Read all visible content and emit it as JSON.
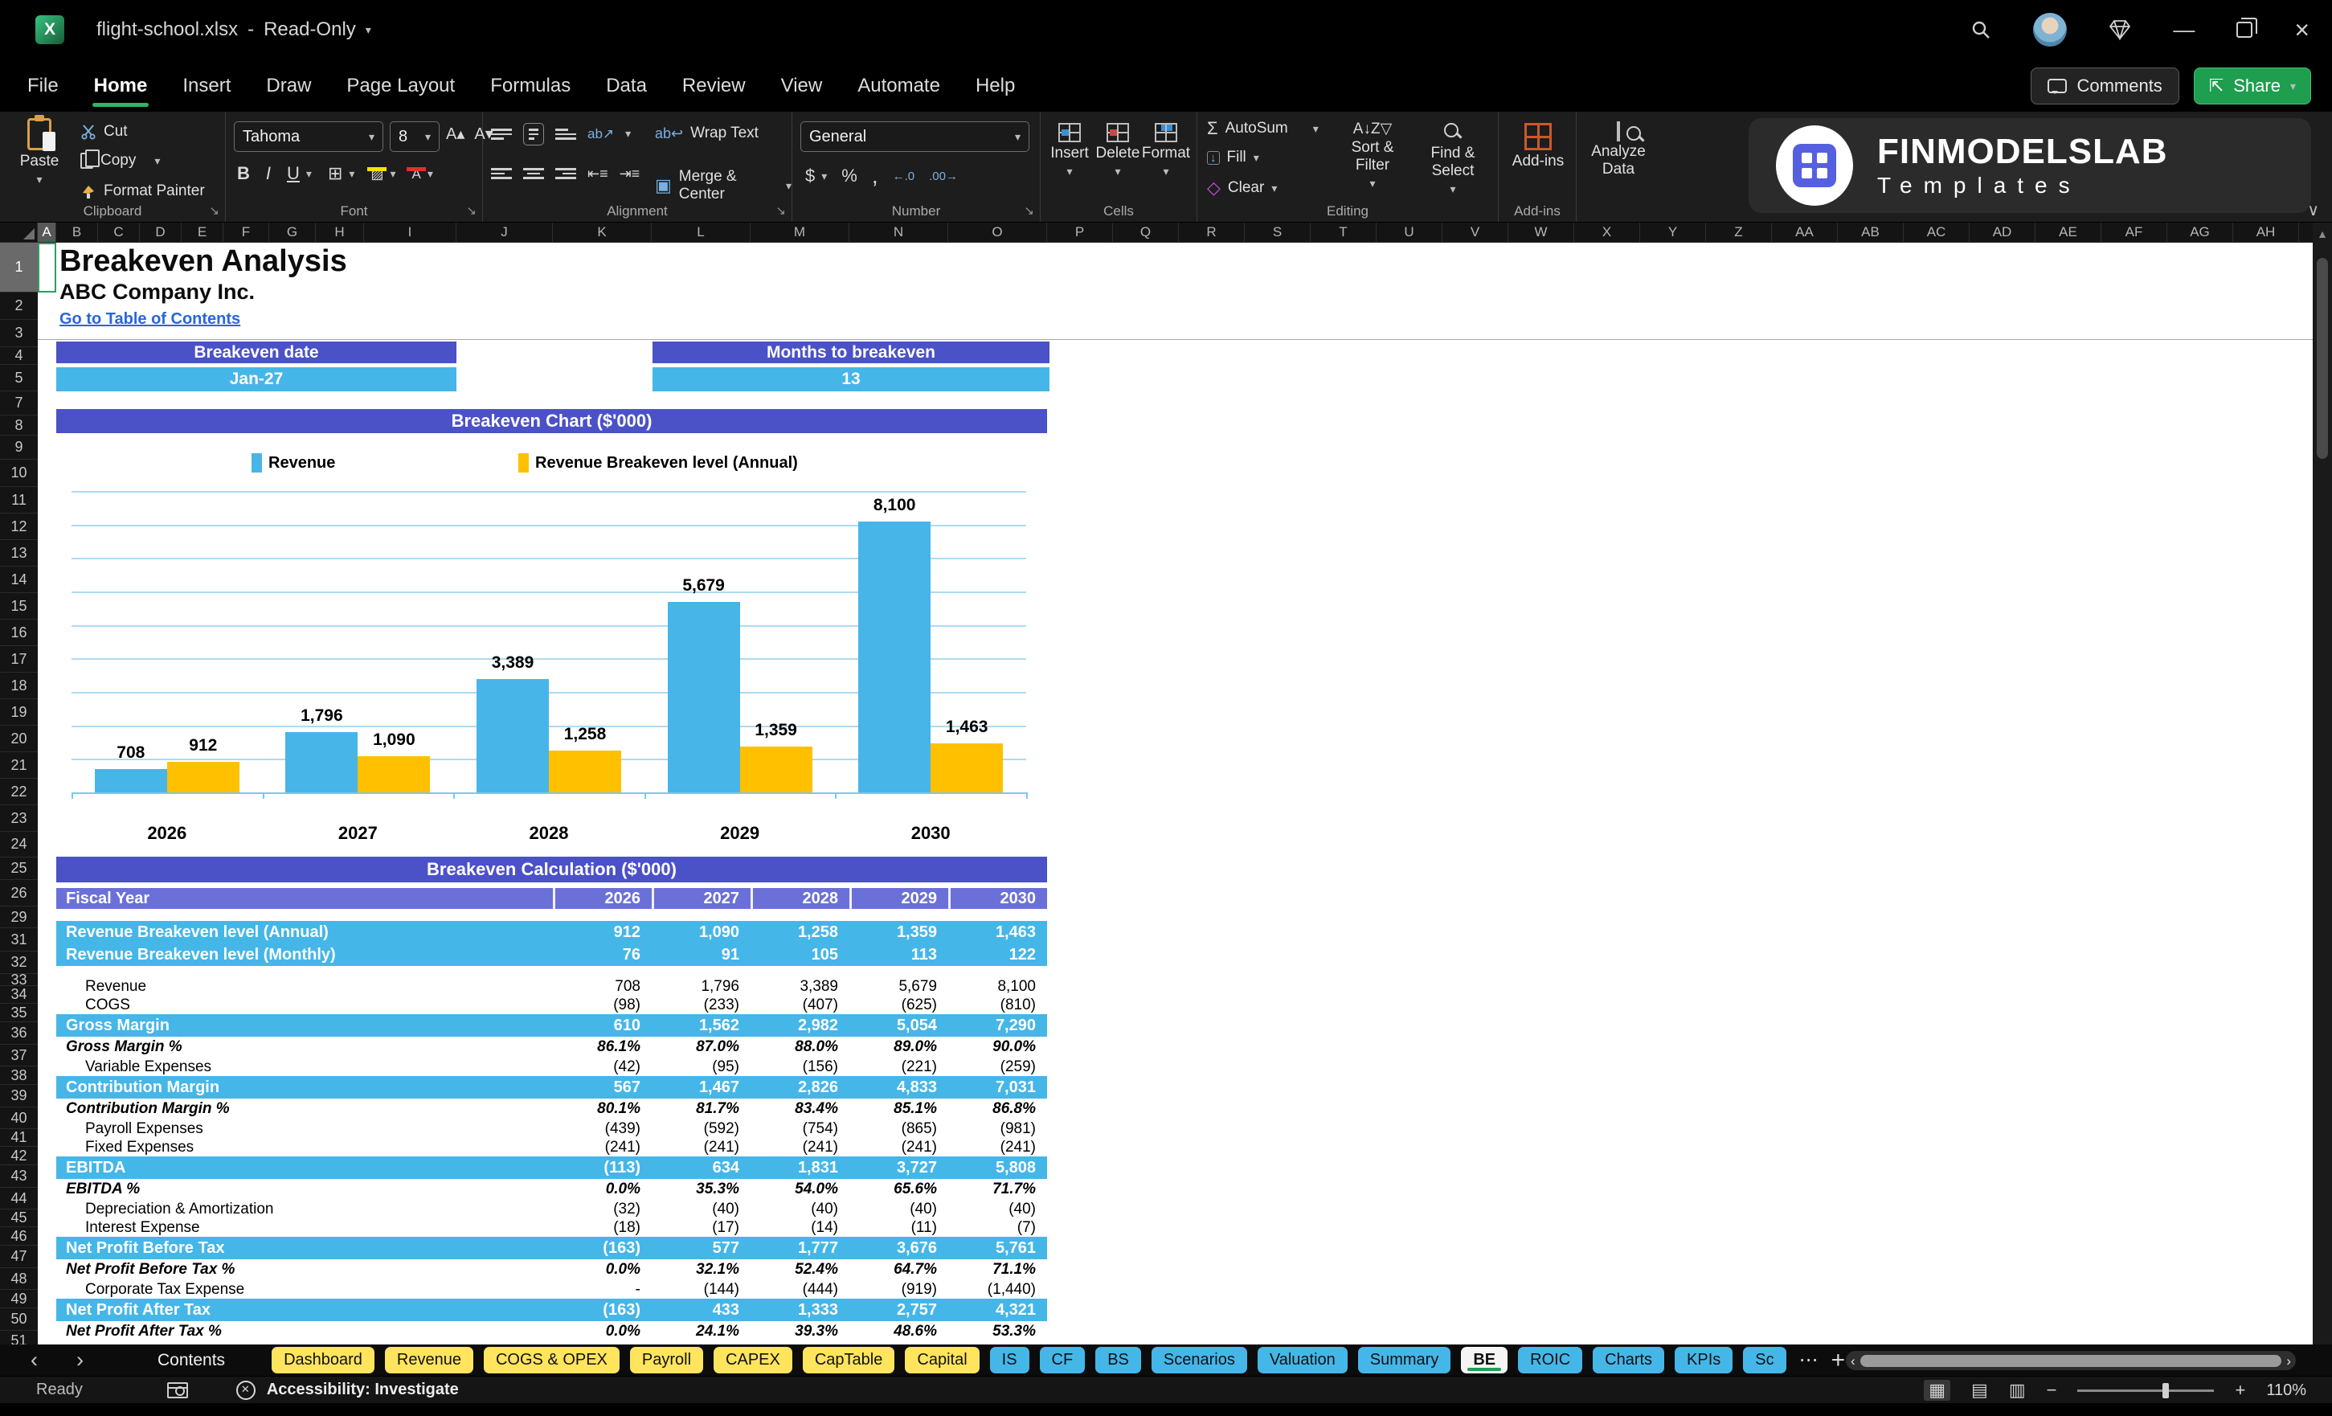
{
  "titlebar": {
    "filename": "flight-school.xlsx",
    "separator": "-",
    "mode": "Read-Only"
  },
  "menu": {
    "tabs": [
      "File",
      "Home",
      "Insert",
      "Draw",
      "Page Layout",
      "Formulas",
      "Data",
      "Review",
      "View",
      "Automate",
      "Help"
    ],
    "active": "Home",
    "comments_label": "Comments",
    "share_label": "Share"
  },
  "ribbon": {
    "clipboard": {
      "label": "Clipboard",
      "paste": "Paste",
      "cut": "Cut",
      "copy": "Copy",
      "format_painter": "Format Painter"
    },
    "font": {
      "label": "Font",
      "family": "Tahoma",
      "size": "8"
    },
    "alignment": {
      "label": "Alignment",
      "wrap": "Wrap Text",
      "merge": "Merge & Center"
    },
    "number": {
      "label": "Number",
      "format": "General"
    },
    "cells": {
      "label": "Cells",
      "insert": "Insert",
      "delete": "Delete",
      "format": "Format"
    },
    "editing": {
      "label": "Editing",
      "autosum": "AutoSum",
      "fill": "Fill",
      "clear": "Clear",
      "sort": "Sort & Filter",
      "find": "Find & Select"
    },
    "addins_label": "Add-ins",
    "analyze_label": "Analyze Data",
    "logo": {
      "brand": "FINMODELSLAB",
      "sub": "Templates"
    }
  },
  "icons": {
    "dropdown": "▾",
    "collapse": "∨",
    "nav_left": "‹",
    "nav_right": "›",
    "more": "⋯",
    "kebab": "⋮",
    "plus": "+",
    "minimize": "—",
    "close": "×",
    "diamond": "◇",
    "autosum": "Σ",
    "bold": "B",
    "italic": "I",
    "underline": "U",
    "borders": "⊞",
    "insert_cells": "⊞",
    "delete_cells": "⊠",
    "format_cells": "⊟",
    "currency": "$",
    "percent": "%",
    "comma": ",",
    "inc_decimal": "←.0",
    "dec_decimal": ".00→",
    "fill_down": "↓",
    "clear": "◇",
    "wrap": "↩",
    "merge": "▣",
    "orientation": "ab↗",
    "sortaz": "A↓Z",
    "fontgrow": "A▴",
    "fontshrink": "A▾",
    "uparrow": "▲"
  },
  "grid": {
    "columns_left": [
      "A",
      "B",
      "C",
      "D",
      "E",
      "F",
      "G",
      "H",
      "I",
      "J",
      "K",
      "L",
      "M",
      "N",
      "O"
    ],
    "columns_right": [
      "P",
      "Q",
      "R",
      "S",
      "T",
      "U",
      "V",
      "W",
      "X",
      "Y",
      "Z",
      "AA",
      "AB",
      "AC",
      "AD",
      "AE",
      "AF",
      "AG",
      "AH"
    ],
    "selected_column": "A",
    "selected_row": "1",
    "rows": [
      {
        "n": "1",
        "h": 62
      },
      {
        "n": "2",
        "h": 34
      },
      {
        "n": "3",
        "h": 34
      },
      {
        "n": "4",
        "h": 22
      },
      {
        "n": "5",
        "h": 33
      },
      {
        "n": "7",
        "h": 30
      },
      {
        "n": "8",
        "h": 25
      },
      {
        "n": "9",
        "h": 30
      },
      {
        "n": "10",
        "h": 34
      },
      {
        "n": "11",
        "h": 33
      },
      {
        "n": "12",
        "h": 33
      },
      {
        "n": "13",
        "h": 33
      },
      {
        "n": "14",
        "h": 33
      },
      {
        "n": "15",
        "h": 33
      },
      {
        "n": "16",
        "h": 33
      },
      {
        "n": "17",
        "h": 33
      },
      {
        "n": "18",
        "h": 33
      },
      {
        "n": "19",
        "h": 33
      },
      {
        "n": "20",
        "h": 33
      },
      {
        "n": "21",
        "h": 33
      },
      {
        "n": "22",
        "h": 33
      },
      {
        "n": "23",
        "h": 33
      },
      {
        "n": "24",
        "h": 32
      },
      {
        "n": "25",
        "h": 28
      },
      {
        "n": "26",
        "h": 33
      },
      {
        "n": "29",
        "h": 27
      },
      {
        "n": "31",
        "h": 29
      },
      {
        "n": "32",
        "h": 28
      },
      {
        "n": "33",
        "h": 15
      },
      {
        "n": "34",
        "h": 22
      },
      {
        "n": "35",
        "h": 23
      },
      {
        "n": "36",
        "h": 28
      },
      {
        "n": "37",
        "h": 27
      },
      {
        "n": "38",
        "h": 23
      },
      {
        "n": "39",
        "h": 28
      },
      {
        "n": "40",
        "h": 27
      },
      {
        "n": "41",
        "h": 22
      },
      {
        "n": "42",
        "h": 23
      },
      {
        "n": "43",
        "h": 28
      },
      {
        "n": "44",
        "h": 27
      },
      {
        "n": "45",
        "h": 22
      },
      {
        "n": "46",
        "h": 23
      },
      {
        "n": "47",
        "h": 28
      },
      {
        "n": "48",
        "h": 27
      },
      {
        "n": "49",
        "h": 23
      },
      {
        "n": "50",
        "h": 28
      },
      {
        "n": "51",
        "h": 25
      }
    ]
  },
  "sheet": {
    "title": "Breakeven Analysis",
    "company": "ABC Company Inc.",
    "link": "Go to Table of Contents",
    "kpis": [
      {
        "label": "Breakeven date",
        "value": "Jan-27"
      },
      {
        "label": "Months to breakeven",
        "value": "13"
      }
    ],
    "chart_title": "Breakeven Chart ($'000)",
    "table_title": "Breakeven Calculation ($'000)"
  },
  "chart_data": {
    "type": "bar",
    "title": "Breakeven Chart ($'000)",
    "categories": [
      "2026",
      "2027",
      "2028",
      "2029",
      "2030"
    ],
    "series": [
      {
        "name": "Revenue",
        "color": "#47b5e8",
        "values": [
          708,
          1796,
          3389,
          5679,
          8100
        ],
        "labels": [
          "708",
          "1,796",
          "3,389",
          "5,679",
          "8,100"
        ]
      },
      {
        "name": "Revenue Breakeven level (Annual)",
        "color": "#ffc000",
        "values": [
          912,
          1090,
          1258,
          1359,
          1463
        ],
        "labels": [
          "912",
          "1,090",
          "1,258",
          "1,359",
          "1,463"
        ]
      }
    ],
    "ylim": [
      0,
      9000
    ],
    "gridline_step": 1000,
    "grid": true,
    "legend_position": "top"
  },
  "table": {
    "header_row": {
      "label": "Fiscal Year",
      "years": [
        "2026",
        "2027",
        "2028",
        "2029",
        "2030"
      ]
    },
    "rows": [
      {
        "label": "Revenue Breakeven level (Annual)",
        "style": "highlight",
        "values": [
          "912",
          "1,090",
          "1,258",
          "1,359",
          "1,463"
        ]
      },
      {
        "label": "Revenue Breakeven level (Monthly)",
        "style": "highlight",
        "values": [
          "76",
          "91",
          "105",
          "113",
          "122"
        ]
      },
      {
        "label": "",
        "style": "spacer",
        "values": [
          "",
          "",
          "",
          "",
          ""
        ]
      },
      {
        "label": "Revenue",
        "style": "item",
        "values": [
          "708",
          "1,796",
          "3,389",
          "5,679",
          "8,100"
        ]
      },
      {
        "label": "COGS",
        "style": "item",
        "values": [
          "(98)",
          "(233)",
          "(407)",
          "(625)",
          "(810)"
        ]
      },
      {
        "label": "Gross Margin",
        "style": "highlight",
        "values": [
          "610",
          "1,562",
          "2,982",
          "5,054",
          "7,290"
        ]
      },
      {
        "label": "Gross Margin %",
        "style": "pct",
        "values": [
          "86.1%",
          "87.0%",
          "88.0%",
          "89.0%",
          "90.0%"
        ]
      },
      {
        "label": "Variable Expenses",
        "style": "item",
        "values": [
          "(42)",
          "(95)",
          "(156)",
          "(221)",
          "(259)"
        ]
      },
      {
        "label": "Contribution Margin",
        "style": "highlight",
        "values": [
          "567",
          "1,467",
          "2,826",
          "4,833",
          "7,031"
        ]
      },
      {
        "label": "Contribution Margin %",
        "style": "pct",
        "values": [
          "80.1%",
          "81.7%",
          "83.4%",
          "85.1%",
          "86.8%"
        ]
      },
      {
        "label": "Payroll Expenses",
        "style": "item",
        "values": [
          "(439)",
          "(592)",
          "(754)",
          "(865)",
          "(981)"
        ]
      },
      {
        "label": "Fixed Expenses",
        "style": "item",
        "values": [
          "(241)",
          "(241)",
          "(241)",
          "(241)",
          "(241)"
        ]
      },
      {
        "label": "EBITDA",
        "style": "highlight",
        "values": [
          "(113)",
          "634",
          "1,831",
          "3,727",
          "5,808"
        ]
      },
      {
        "label": "EBITDA %",
        "style": "pct",
        "values": [
          "0.0%",
          "35.3%",
          "54.0%",
          "65.6%",
          "71.7%"
        ]
      },
      {
        "label": "Depreciation & Amortization",
        "style": "item",
        "values": [
          "(32)",
          "(40)",
          "(40)",
          "(40)",
          "(40)"
        ]
      },
      {
        "label": "Interest Expense",
        "style": "item",
        "values": [
          "(18)",
          "(17)",
          "(14)",
          "(11)",
          "(7)"
        ]
      },
      {
        "label": "Net Profit Before Tax",
        "style": "highlight",
        "values": [
          "(163)",
          "577",
          "1,777",
          "3,676",
          "5,761"
        ]
      },
      {
        "label": "Net Profit Before Tax %",
        "style": "pct",
        "values": [
          "0.0%",
          "32.1%",
          "52.4%",
          "64.7%",
          "71.1%"
        ]
      },
      {
        "label": "Corporate Tax Expense",
        "style": "item",
        "values": [
          "-",
          "(144)",
          "(444)",
          "(919)",
          "(1,440)"
        ]
      },
      {
        "label": "Net Profit After Tax",
        "style": "highlight",
        "values": [
          "(163)",
          "433",
          "1,333",
          "2,757",
          "4,321"
        ]
      },
      {
        "label": "Net Profit After Tax %",
        "style": "pct",
        "values": [
          "0.0%",
          "24.1%",
          "39.3%",
          "48.6%",
          "53.3%"
        ]
      }
    ]
  },
  "tabs": {
    "contents_label": "Contents",
    "items": [
      {
        "label": "Dashboard",
        "color": "yellow"
      },
      {
        "label": "Revenue",
        "color": "yellow"
      },
      {
        "label": "COGS & OPEX",
        "color": "yellow"
      },
      {
        "label": "Payroll",
        "color": "yellow"
      },
      {
        "label": "CAPEX",
        "color": "yellow"
      },
      {
        "label": "CapTable",
        "color": "yellow"
      },
      {
        "label": "Capital",
        "color": "yellow"
      },
      {
        "label": "IS",
        "color": "blue"
      },
      {
        "label": "CF",
        "color": "blue"
      },
      {
        "label": "BS",
        "color": "blue"
      },
      {
        "label": "Scenarios",
        "color": "blue"
      },
      {
        "label": "Valuation",
        "color": "blue"
      },
      {
        "label": "Summary",
        "color": "blue"
      },
      {
        "label": "BE",
        "color": "active"
      },
      {
        "label": "ROIC",
        "color": "blue"
      },
      {
        "label": "Charts",
        "color": "blue"
      },
      {
        "label": "KPIs",
        "color": "blue"
      },
      {
        "label": "Sc",
        "color": "blue"
      }
    ]
  },
  "statusbar": {
    "ready": "Ready",
    "accessibility": "Accessibility: Investigate",
    "zoom": "110%"
  },
  "colors": {
    "header_indigo": "#4b51c7",
    "fiscal_periwinkle": "#6b70d8",
    "row_blue": "#45b6e8",
    "bar_blue": "#47b5e8",
    "bar_gold": "#ffc000",
    "tab_yellow": "#ffe45e",
    "tab_blue": "#45b6e8",
    "active_green": "#1e9e55",
    "share_green": "#1e9e4f"
  }
}
